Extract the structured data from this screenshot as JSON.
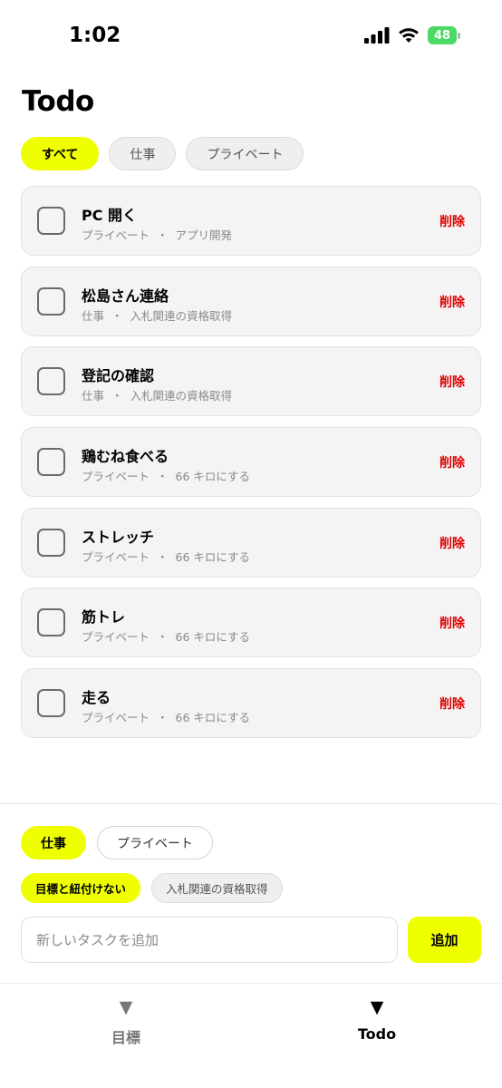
{
  "status_bar": {
    "time": "1:02",
    "battery": "48"
  },
  "header": {
    "title": "Todo"
  },
  "filters": [
    {
      "label": "すべて",
      "active": true
    },
    {
      "label": "仕事",
      "active": false
    },
    {
      "label": "プライベート",
      "active": false
    }
  ],
  "tasks": [
    {
      "title": "PC 開く",
      "category": "プライベート",
      "goal": "アプリ開発",
      "delete_label": "削除"
    },
    {
      "title": "松島さん連絡",
      "category": "仕事",
      "goal": "入札関連の資格取得",
      "delete_label": "削除"
    },
    {
      "title": "登記の確認",
      "category": "仕事",
      "goal": "入札関連の資格取得",
      "delete_label": "削除"
    },
    {
      "title": "鶏むね食べる",
      "category": "プライベート",
      "goal": "66 キロにする",
      "delete_label": "削除"
    },
    {
      "title": "ストレッチ",
      "category": "プライベート",
      "goal": "66 キロにする",
      "delete_label": "削除"
    },
    {
      "title": "筋トレ",
      "category": "プライベート",
      "goal": "66 キロにする",
      "delete_label": "削除"
    },
    {
      "title": "走る",
      "category": "プライベート",
      "goal": "66 キロにする",
      "delete_label": "削除"
    }
  ],
  "separator": "・",
  "composer": {
    "categories": [
      {
        "label": "仕事",
        "active": true
      },
      {
        "label": "プライベート",
        "active": false
      }
    ],
    "goals": [
      {
        "label": "目標と紐付けない",
        "active": true
      },
      {
        "label": "入札関連の資格取得",
        "active": false
      }
    ],
    "input_value": "",
    "input_placeholder": "新しいタスクを追加",
    "add_label": "追加"
  },
  "tab_bar": [
    {
      "label": "目標",
      "icon": "▼",
      "icon_name": "triangle-down-icon",
      "active": false
    },
    {
      "label": "Todo",
      "icon": "▼",
      "icon_name": "triangle-down-icon",
      "active": true
    }
  ],
  "colors": {
    "accent": "#f0ff00",
    "delete": "#e00000",
    "card_bg": "#f4f4f4"
  }
}
